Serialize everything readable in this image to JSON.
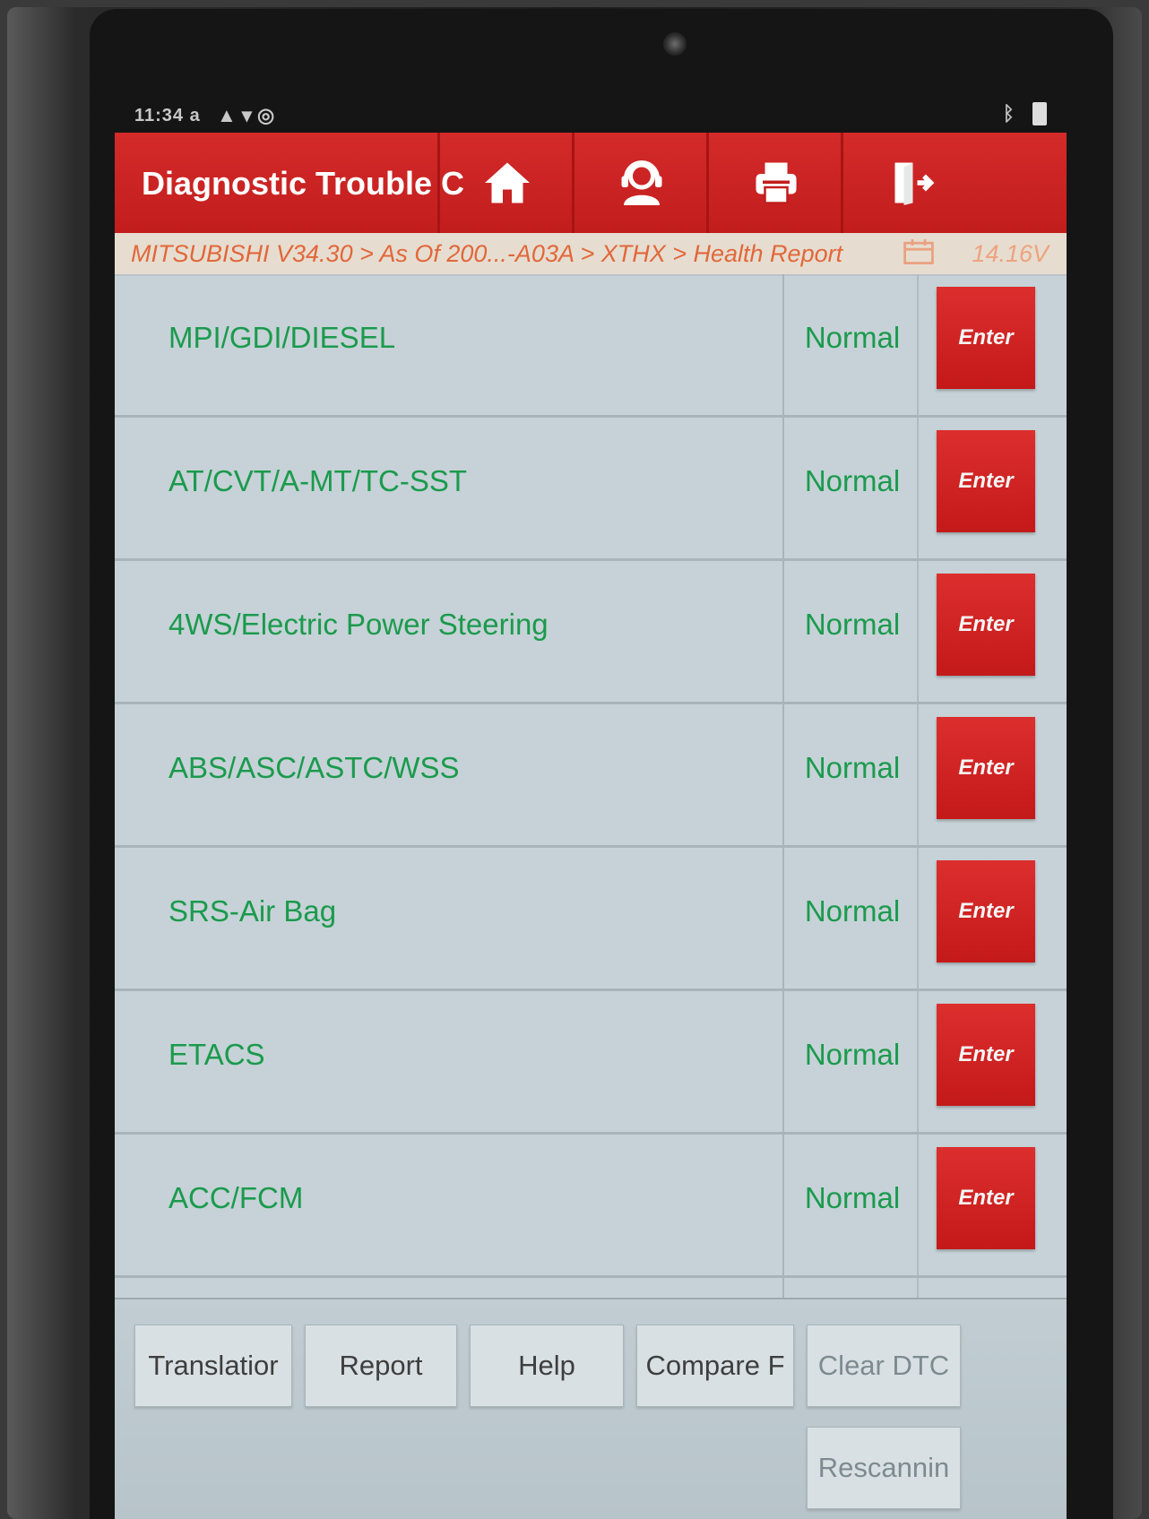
{
  "status_bar": {
    "time": "11:34 a",
    "icons": "▲ ▾ ◎"
  },
  "header": {
    "title": "Diagnostic Trouble C",
    "buttons": [
      {
        "icon": "home-icon"
      },
      {
        "icon": "support-agent-icon"
      },
      {
        "icon": "printer-icon"
      },
      {
        "icon": "exit-icon"
      }
    ]
  },
  "breadcrumb": {
    "path": "MITSUBISHI V34.30 > As Of 200...-A03A > XTHX > Health Report",
    "voltage": "14.16V"
  },
  "systems": [
    {
      "name": "MPI/GDI/DIESEL",
      "status": "Normal",
      "action": "Enter"
    },
    {
      "name": "AT/CVT/A-MT/TC-SST",
      "status": "Normal",
      "action": "Enter"
    },
    {
      "name": "4WS/Electric Power Steering",
      "status": "Normal",
      "action": "Enter"
    },
    {
      "name": "ABS/ASC/ASTC/WSS",
      "status": "Normal",
      "action": "Enter"
    },
    {
      "name": "SRS-Air Bag",
      "status": "Normal",
      "action": "Enter"
    },
    {
      "name": "ETACS",
      "status": "Normal",
      "action": "Enter"
    },
    {
      "name": "ACC/FCM",
      "status": "Normal",
      "action": "Enter"
    }
  ],
  "footer": {
    "translation": "Translatior",
    "report": "Report",
    "help": "Help",
    "compare": "Compare F",
    "clear_dtc": "Clear DTC",
    "rescanning": "Rescannin"
  },
  "colors": {
    "accent_red": "#c41919",
    "ok_green": "#1b9a4d",
    "breadcrumb_orange": "#e2673a"
  }
}
